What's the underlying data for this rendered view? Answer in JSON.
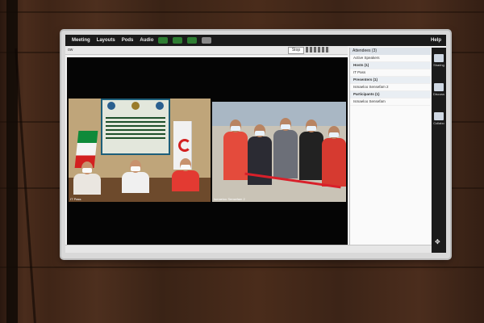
{
  "menubar": {
    "items": [
      "Meeting",
      "Layouts",
      "Pods",
      "Audio"
    ],
    "help": "Help"
  },
  "toolbar": {
    "view_label": "ow",
    "stop_label": "Stop"
  },
  "video": {
    "left_caption": "IT Pass",
    "right_caption": "Ismaeloo Sensefam 2"
  },
  "attendees": {
    "title": "Attendees (3)",
    "rows": [
      {
        "label": "Active Speakers",
        "section": false
      },
      {
        "label": "Hosts (1)",
        "section": true
      },
      {
        "label": "IT Pass",
        "section": false
      },
      {
        "label": "Presenters (1)",
        "section": true
      },
      {
        "label": "Ismaeloo Sensefam 2",
        "section": false
      },
      {
        "label": "Participants (1)",
        "section": true
      },
      {
        "label": "Ismaeloo Sensefam",
        "section": false
      }
    ]
  },
  "rail": {
    "items": [
      "Sharing",
      "Discuss",
      "Collabo"
    ]
  },
  "colors": {
    "wall": "#3a2317",
    "menubar": "#1a1a1a",
    "red_crescent": "#d32020"
  }
}
